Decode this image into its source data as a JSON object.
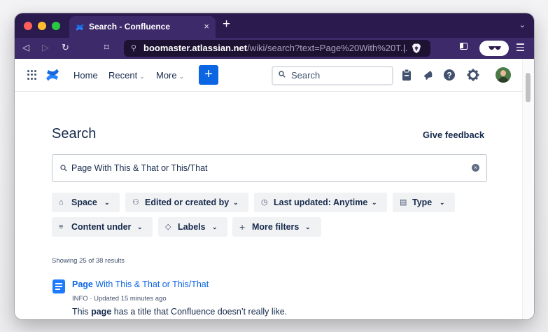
{
  "browser": {
    "tab": {
      "title": "Search - Confluence",
      "close": "×"
    },
    "new_tab": "+",
    "tab_menu": "⌄",
    "nav": {
      "back": "◁",
      "forward": "▷",
      "reload": "↻",
      "bookmark": "⌑"
    },
    "url": {
      "icon": "⚲",
      "host": "boomaster.atlassian.net",
      "path": "/wiki/search?text=Page%20With%20T...",
      "separator": "|"
    }
  },
  "confluence_nav": {
    "home": "Home",
    "recent": "Recent",
    "more": "More",
    "create": "+",
    "search_placeholder": "Search"
  },
  "page": {
    "title": "Search",
    "give_feedback": "Give feedback",
    "search_value": "Page With This & That or This/That",
    "clear": "×",
    "filters": [
      {
        "icon": "⌂",
        "label": "Space"
      },
      {
        "icon": "⚇",
        "label": "Edited or created by"
      },
      {
        "icon": "◷",
        "label": "Last updated: Anytime"
      },
      {
        "icon": "▤",
        "label": "Type"
      },
      {
        "icon": "≡",
        "label": "Content under"
      },
      {
        "icon": "◇",
        "label": "Labels"
      },
      {
        "icon": "+",
        "label": "More filters"
      }
    ],
    "chevron": "⌄",
    "results_count": "Showing 25 of 38 results",
    "results": [
      {
        "title_highlight": "Page",
        "title_rest": " With This & That or This/That",
        "meta": "INFO · Updated 15 minutes ago",
        "excerpt_pre": "This ",
        "excerpt_highlight": "page",
        "excerpt_post": " has a title that Confluence doesn’t really like."
      }
    ]
  },
  "colors": {
    "browser_chrome": "#2b1a4e",
    "toolbar": "#3d2a6a",
    "accent_blue": "#0c66e4",
    "text": "#172b4d"
  }
}
